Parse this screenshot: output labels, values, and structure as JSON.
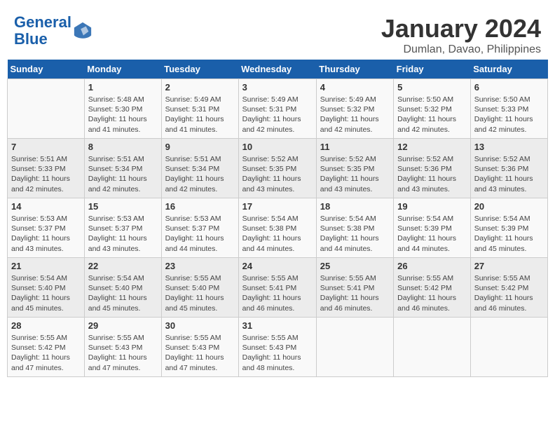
{
  "header": {
    "logo_line1": "General",
    "logo_line2": "Blue",
    "month_year": "January 2024",
    "location": "Dumlan, Davao, Philippines"
  },
  "days_of_week": [
    "Sunday",
    "Monday",
    "Tuesday",
    "Wednesday",
    "Thursday",
    "Friday",
    "Saturday"
  ],
  "weeks": [
    [
      {
        "day": "",
        "detail": ""
      },
      {
        "day": "1",
        "detail": "Sunrise: 5:48 AM\nSunset: 5:30 PM\nDaylight: 11 hours\nand 41 minutes."
      },
      {
        "day": "2",
        "detail": "Sunrise: 5:49 AM\nSunset: 5:31 PM\nDaylight: 11 hours\nand 41 minutes."
      },
      {
        "day": "3",
        "detail": "Sunrise: 5:49 AM\nSunset: 5:31 PM\nDaylight: 11 hours\nand 42 minutes."
      },
      {
        "day": "4",
        "detail": "Sunrise: 5:49 AM\nSunset: 5:32 PM\nDaylight: 11 hours\nand 42 minutes."
      },
      {
        "day": "5",
        "detail": "Sunrise: 5:50 AM\nSunset: 5:32 PM\nDaylight: 11 hours\nand 42 minutes."
      },
      {
        "day": "6",
        "detail": "Sunrise: 5:50 AM\nSunset: 5:33 PM\nDaylight: 11 hours\nand 42 minutes."
      }
    ],
    [
      {
        "day": "7",
        "detail": "Sunrise: 5:51 AM\nSunset: 5:33 PM\nDaylight: 11 hours\nand 42 minutes."
      },
      {
        "day": "8",
        "detail": "Sunrise: 5:51 AM\nSunset: 5:34 PM\nDaylight: 11 hours\nand 42 minutes."
      },
      {
        "day": "9",
        "detail": "Sunrise: 5:51 AM\nSunset: 5:34 PM\nDaylight: 11 hours\nand 42 minutes."
      },
      {
        "day": "10",
        "detail": "Sunrise: 5:52 AM\nSunset: 5:35 PM\nDaylight: 11 hours\nand 43 minutes."
      },
      {
        "day": "11",
        "detail": "Sunrise: 5:52 AM\nSunset: 5:35 PM\nDaylight: 11 hours\nand 43 minutes."
      },
      {
        "day": "12",
        "detail": "Sunrise: 5:52 AM\nSunset: 5:36 PM\nDaylight: 11 hours\nand 43 minutes."
      },
      {
        "day": "13",
        "detail": "Sunrise: 5:52 AM\nSunset: 5:36 PM\nDaylight: 11 hours\nand 43 minutes."
      }
    ],
    [
      {
        "day": "14",
        "detail": "Sunrise: 5:53 AM\nSunset: 5:37 PM\nDaylight: 11 hours\nand 43 minutes."
      },
      {
        "day": "15",
        "detail": "Sunrise: 5:53 AM\nSunset: 5:37 PM\nDaylight: 11 hours\nand 43 minutes."
      },
      {
        "day": "16",
        "detail": "Sunrise: 5:53 AM\nSunset: 5:37 PM\nDaylight: 11 hours\nand 44 minutes."
      },
      {
        "day": "17",
        "detail": "Sunrise: 5:54 AM\nSunset: 5:38 PM\nDaylight: 11 hours\nand 44 minutes."
      },
      {
        "day": "18",
        "detail": "Sunrise: 5:54 AM\nSunset: 5:38 PM\nDaylight: 11 hours\nand 44 minutes."
      },
      {
        "day": "19",
        "detail": "Sunrise: 5:54 AM\nSunset: 5:39 PM\nDaylight: 11 hours\nand 44 minutes."
      },
      {
        "day": "20",
        "detail": "Sunrise: 5:54 AM\nSunset: 5:39 PM\nDaylight: 11 hours\nand 45 minutes."
      }
    ],
    [
      {
        "day": "21",
        "detail": "Sunrise: 5:54 AM\nSunset: 5:40 PM\nDaylight: 11 hours\nand 45 minutes."
      },
      {
        "day": "22",
        "detail": "Sunrise: 5:54 AM\nSunset: 5:40 PM\nDaylight: 11 hours\nand 45 minutes."
      },
      {
        "day": "23",
        "detail": "Sunrise: 5:55 AM\nSunset: 5:40 PM\nDaylight: 11 hours\nand 45 minutes."
      },
      {
        "day": "24",
        "detail": "Sunrise: 5:55 AM\nSunset: 5:41 PM\nDaylight: 11 hours\nand 46 minutes."
      },
      {
        "day": "25",
        "detail": "Sunrise: 5:55 AM\nSunset: 5:41 PM\nDaylight: 11 hours\nand 46 minutes."
      },
      {
        "day": "26",
        "detail": "Sunrise: 5:55 AM\nSunset: 5:42 PM\nDaylight: 11 hours\nand 46 minutes."
      },
      {
        "day": "27",
        "detail": "Sunrise: 5:55 AM\nSunset: 5:42 PM\nDaylight: 11 hours\nand 46 minutes."
      }
    ],
    [
      {
        "day": "28",
        "detail": "Sunrise: 5:55 AM\nSunset: 5:42 PM\nDaylight: 11 hours\nand 47 minutes."
      },
      {
        "day": "29",
        "detail": "Sunrise: 5:55 AM\nSunset: 5:43 PM\nDaylight: 11 hours\nand 47 minutes."
      },
      {
        "day": "30",
        "detail": "Sunrise: 5:55 AM\nSunset: 5:43 PM\nDaylight: 11 hours\nand 47 minutes."
      },
      {
        "day": "31",
        "detail": "Sunrise: 5:55 AM\nSunset: 5:43 PM\nDaylight: 11 hours\nand 48 minutes."
      },
      {
        "day": "",
        "detail": ""
      },
      {
        "day": "",
        "detail": ""
      },
      {
        "day": "",
        "detail": ""
      }
    ]
  ]
}
